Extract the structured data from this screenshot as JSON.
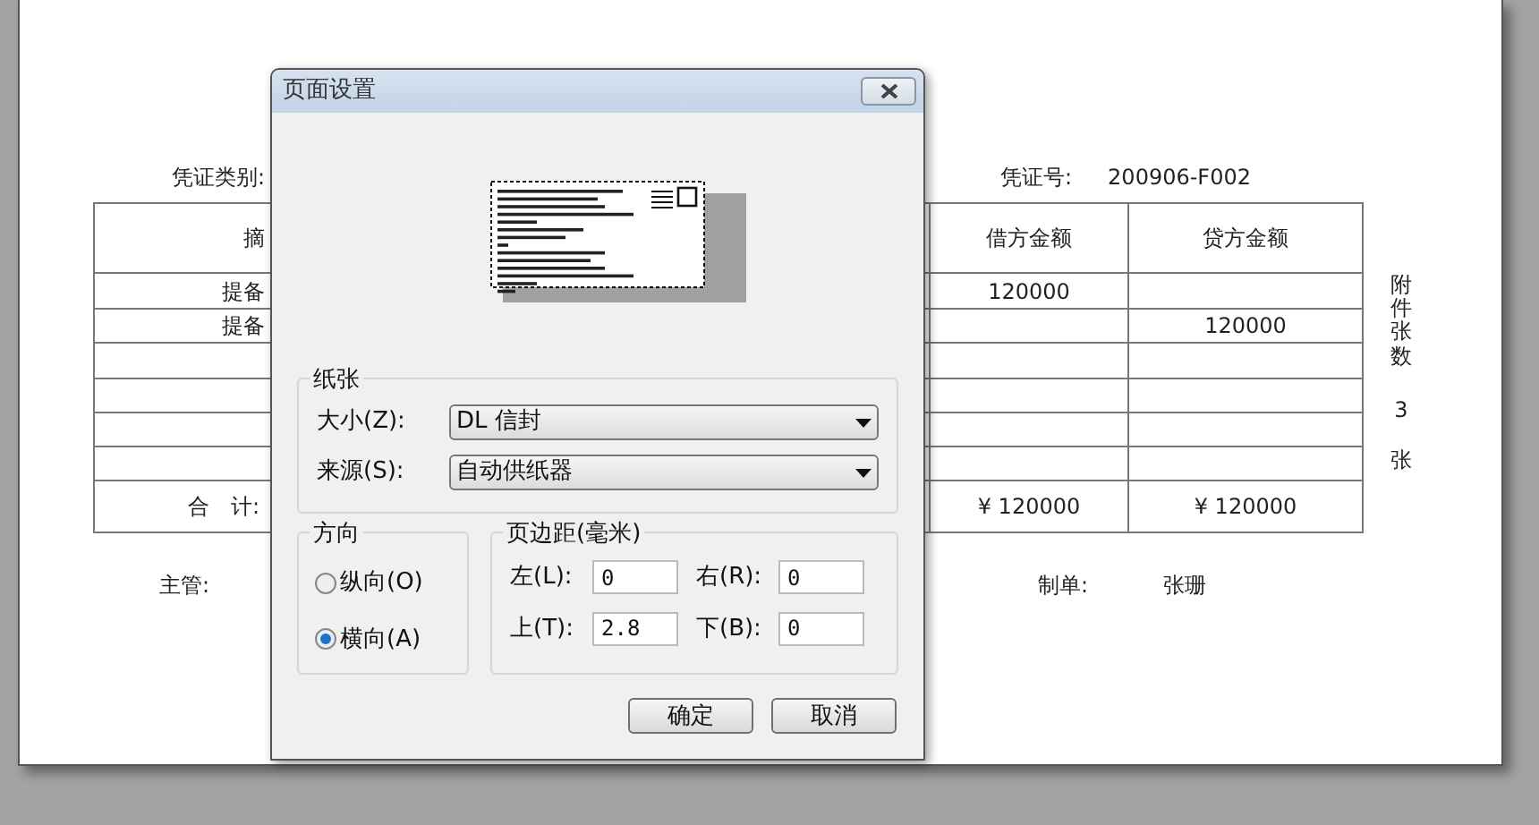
{
  "voucher": {
    "type_label": "凭证类别:",
    "number_label": "凭证号:",
    "number": "200906-F002",
    "columns": [
      "摘",
      "借方金额",
      "贷方金额"
    ],
    "rows": [
      [
        "提备",
        "120000",
        ""
      ],
      [
        "提备",
        "",
        "120000"
      ],
      [
        "",
        "",
        ""
      ],
      [
        "",
        "",
        ""
      ],
      [
        "",
        "",
        ""
      ],
      [
        "",
        "",
        ""
      ]
    ],
    "total": {
      "label": "合　计:",
      "debit": "¥ 120000",
      "credit": "¥ 120000"
    },
    "attachments": {
      "label": "附件张数",
      "count": "3",
      "unit": "张"
    },
    "supervisor_label": "主管:",
    "maker_label": "制单:",
    "maker": "张珊"
  },
  "dialog": {
    "title": "页面设置",
    "paper": {
      "legend": "纸张",
      "size_label": "大小(Z):",
      "size": "DL 信封",
      "source_label": "来源(S):",
      "source": "自动供纸器"
    },
    "orientation": {
      "legend": "方向",
      "options": [
        {
          "label": "纵向(O)",
          "selected": false
        },
        {
          "label": "横向(A)",
          "selected": true
        }
      ]
    },
    "margins": {
      "legend": "页边距(毫米)",
      "fields": [
        {
          "label": "左(L):",
          "value": "0"
        },
        {
          "label": "右(R):",
          "value": "0"
        },
        {
          "label": "上(T):",
          "value": "2.8"
        },
        {
          "label": "下(B):",
          "value": "0"
        }
      ]
    },
    "buttons": [
      "确定",
      "取消"
    ]
  }
}
